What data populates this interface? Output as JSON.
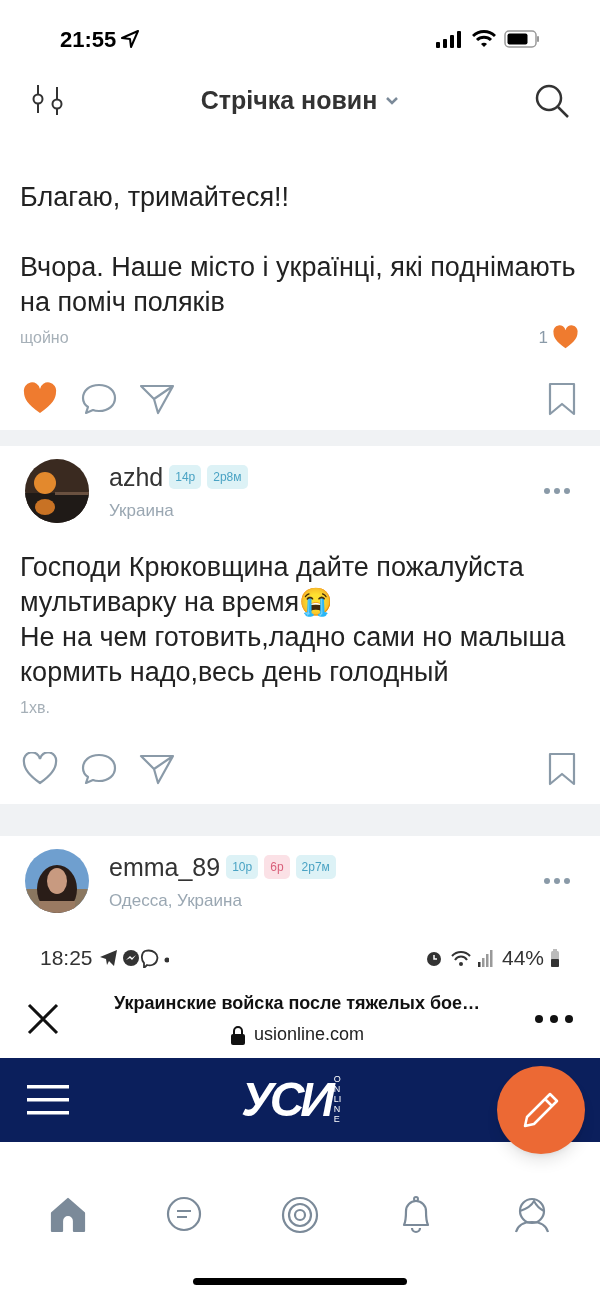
{
  "status_bar": {
    "time": "21:55"
  },
  "header": {
    "title": "Стрічка новин"
  },
  "posts": [
    {
      "kind": "partial",
      "paragraphs": [
        "Благаю, тримайтеся!!",
        "Вчора. Наше місто і українці, які поднімають на поміч поляків"
      ],
      "time": "щойно",
      "like_count": "1",
      "liked": true
    },
    {
      "kind": "text",
      "author": "azhd",
      "badges": [
        {
          "text": "14р",
          "color": "#4aa3c4"
        },
        {
          "text": "2р8м",
          "color": "#4aa3c4"
        }
      ],
      "location": "Украина",
      "paragraphs": [
        "Господи Крюковщина дайте пожалуйста мультиварку на время😭\nНе на чем готовить,ладно сами  но малыша кормить надо,весь день голодный"
      ],
      "time": "1хв.",
      "liked": false
    },
    {
      "kind": "screenshot",
      "author": "emma_89",
      "badges": [
        {
          "text": "10р",
          "color": "#4aa3c4"
        },
        {
          "text": "6р",
          "color": "#d9607a"
        },
        {
          "text": "2р7м",
          "color": "#4aa3c4"
        }
      ],
      "location": "Одесса, Украина",
      "screenshot": {
        "time": "18:25",
        "battery": "44%",
        "page_title": "Украинские войска после тяжелых бое…",
        "url": "usionline.com",
        "logo": "УСИ",
        "logo_sub": "ONLINE"
      }
    }
  ],
  "tabs": [
    {
      "kind": "home",
      "selected": true
    },
    {
      "kind": "chat",
      "selected": false
    },
    {
      "kind": "target",
      "selected": false
    },
    {
      "kind": "bell",
      "selected": false
    },
    {
      "kind": "profile",
      "selected": false
    }
  ]
}
